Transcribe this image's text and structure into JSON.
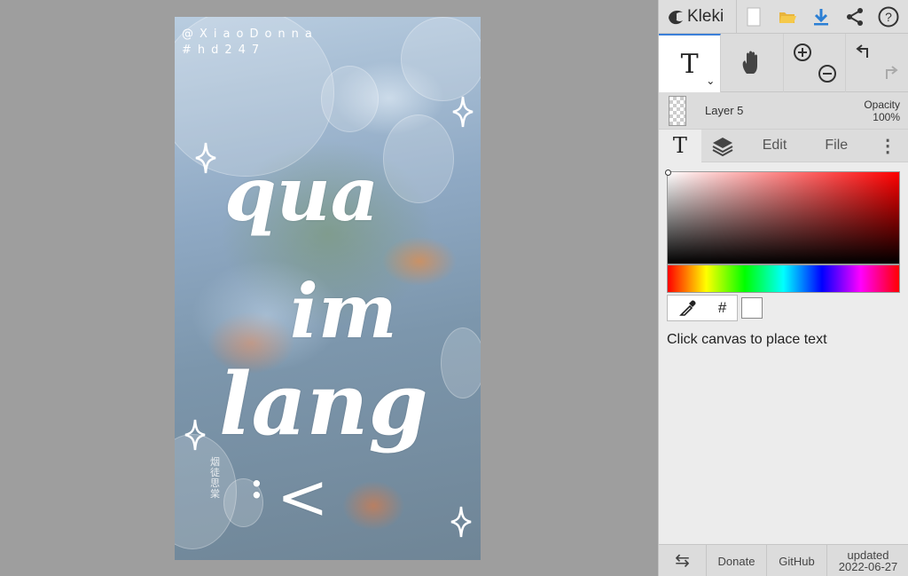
{
  "canvas": {
    "handle_line1": "@XiaoDonna",
    "handle_line2": "#hd247",
    "lettering": [
      "qua",
      "im",
      "lang"
    ],
    "stamp_text": "烟徒思棠",
    "bracket": "<",
    "dots": ":"
  },
  "topbar": {
    "app_name": "Kleki",
    "icons": [
      "new-file-icon",
      "open-folder-icon",
      "download-icon",
      "share-icon",
      "help-icon"
    ],
    "accent_color": "#2b7fd4"
  },
  "tools": {
    "text_tool": "T",
    "expand_glyph": "⌄"
  },
  "layer": {
    "name": "Layer 5",
    "opacity_label": "Opacity",
    "opacity_value": "100%"
  },
  "tabs": {
    "text_glyph": "T",
    "edit": "Edit",
    "file": "File",
    "more": "⋮"
  },
  "color": {
    "selected": "#ffffff",
    "hex_glyph": "#",
    "hint": "Click canvas to place text"
  },
  "footer": {
    "swap_glyph": "⇆",
    "donate": "Donate",
    "github": "GitHub",
    "updated_label": "updated",
    "updated_date": "2022-06-27"
  }
}
